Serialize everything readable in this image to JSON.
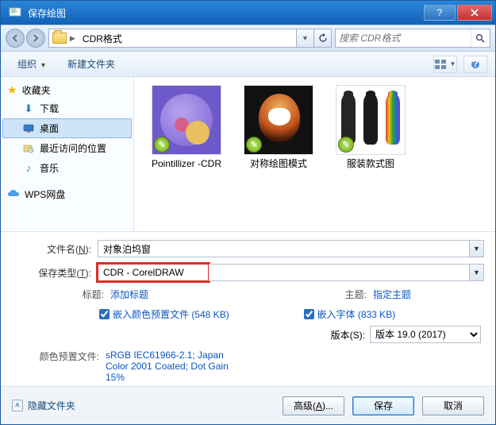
{
  "window": {
    "title": "保存绘图"
  },
  "address": {
    "path_label": "CDR格式",
    "search_placeholder": "搜索 CDR格式"
  },
  "toolbar": {
    "organize": "组织",
    "newfolder": "新建文件夹"
  },
  "sidebar": {
    "fav_header": "收藏夹",
    "items": [
      {
        "label": "下载",
        "icon": "download-icon"
      },
      {
        "label": "桌面",
        "icon": "desktop-icon"
      },
      {
        "label": "最近访问的位置",
        "icon": "recent-icon"
      },
      {
        "label": "音乐",
        "icon": "music-icon"
      }
    ],
    "wps_header": "WPS网盘"
  },
  "thumbs": [
    {
      "label": "Pointillizer -CDR"
    },
    {
      "label": "对称绘图模式"
    },
    {
      "label": "服装款式图"
    }
  ],
  "form": {
    "filename_label_pre": "文件名(",
    "filename_label_ul": "N",
    "filename_label_post": "):",
    "filename_value": "对象泊坞窗",
    "savetype_label_pre": "保存类型(",
    "savetype_label_ul": "T",
    "savetype_label_post": "):",
    "savetype_value": "CDR - CorelDRAW",
    "title_label": "标题:",
    "title_link": "添加标题",
    "subject_label": "主题:",
    "subject_link": "指定主题",
    "embed_color_label": "嵌入颜色预置文件 (548 KB)",
    "embed_font_label": "嵌入字体 (833 KB)",
    "version_label_pre": "版本(",
    "version_label_ul": "S",
    "version_label_post": "):",
    "version_value": "版本 19.0 (2017)",
    "profile_label": "颜色预置文件:",
    "profile_value": "sRGB IEC61966-2.1; Japan Color 2001 Coated; Dot Gain 15%"
  },
  "footer": {
    "hidden": "隐藏文件夹",
    "advanced_pre": "高级(",
    "advanced_ul": "A",
    "advanced_post": ")...",
    "save": "保存",
    "cancel": "取消"
  }
}
